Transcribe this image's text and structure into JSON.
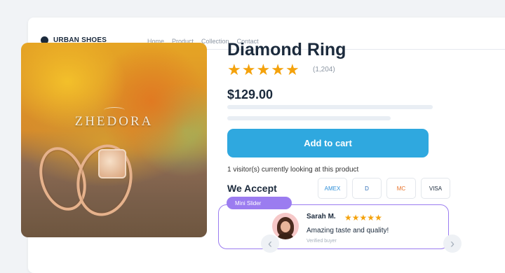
{
  "brand": {
    "name": "URBAN SHOES"
  },
  "nav": {
    "links": [
      "Home",
      "Product",
      "Collection",
      "Contact"
    ]
  },
  "product": {
    "image_brand": "ZHEDORA",
    "title": "Diamond Ring",
    "rating": 5,
    "review_count": "(1,204)",
    "price": "$129.00",
    "add_to_cart": "Add to cart",
    "visitors": "1 visitor(s) currently looking at this product"
  },
  "payments": {
    "heading": "We Accept",
    "methods": [
      {
        "label": "AMEX",
        "color": "#2f8fd8"
      },
      {
        "label": "D",
        "color": "#2f6fb8"
      },
      {
        "label": "MC",
        "color": "#e8732a"
      },
      {
        "label": "VISA",
        "color": "#1b2a3c"
      }
    ]
  },
  "slider": {
    "tag": "Mini Slider",
    "prev_icon": "chevron-left-icon",
    "next_icon": "chevron-right-icon",
    "review": {
      "name": "Sarah M.",
      "rating": 5,
      "text": "Amazing taste and quality!",
      "verified": "Verified buyer"
    }
  },
  "colors": {
    "accent": "#2fa8df",
    "star": "#f4a20c",
    "slider_border": "#9b7cf0",
    "dark": "#1b2a3c"
  }
}
